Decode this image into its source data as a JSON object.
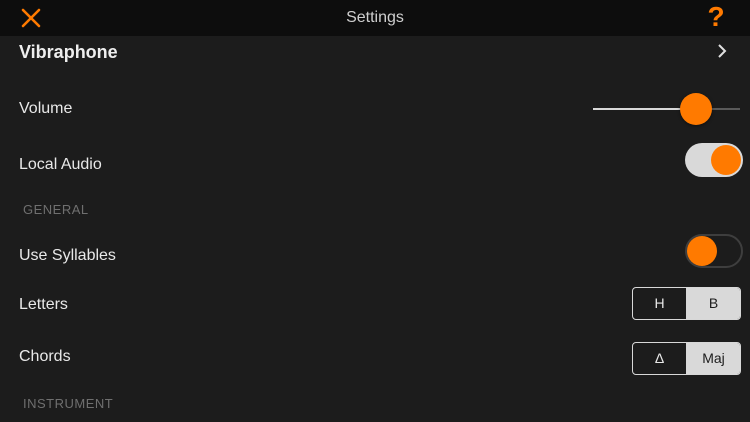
{
  "nav": {
    "title": "Settings",
    "close_icon": "close-icon",
    "help_label": "?"
  },
  "instrument": {
    "name": "Vibraphone"
  },
  "volume": {
    "label": "Volume",
    "value_fraction": 0.7
  },
  "local_audio": {
    "label": "Local Audio",
    "on": true
  },
  "sections": {
    "general": "GENERAL",
    "instrument": "INSTRUMENT"
  },
  "use_syllables": {
    "label": "Use Syllables",
    "on": false
  },
  "letters": {
    "label": "Letters",
    "options": [
      "H",
      "B"
    ],
    "selected": "B"
  },
  "chords": {
    "label": "Chords",
    "options": [
      "Δ",
      "Maj"
    ],
    "selected": "Maj"
  },
  "colors": {
    "accent": "#ff7a00",
    "background": "#1c1c1c",
    "navbar": "#0d0d0d"
  }
}
